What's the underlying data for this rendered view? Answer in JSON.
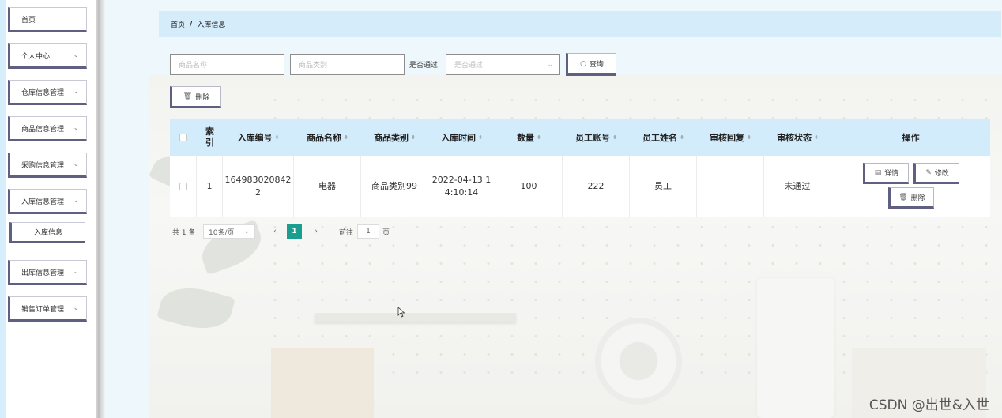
{
  "sidebar": {
    "items": [
      {
        "label": "首页",
        "chevron": false
      },
      {
        "label": "个人中心",
        "chevron": true
      },
      {
        "label": "仓库信息管理",
        "chevron": true
      },
      {
        "label": "商品信息管理",
        "chevron": true
      },
      {
        "label": "采购信息管理",
        "chevron": true
      },
      {
        "label": "入库信息管理",
        "chevron": true
      },
      {
        "label": "出库信息管理",
        "chevron": true
      },
      {
        "label": "销售订单管理",
        "chevron": true
      }
    ],
    "sub_item": "入库信息"
  },
  "breadcrumb": {
    "home": "首页",
    "separator": "/",
    "current": "入库信息"
  },
  "filters": {
    "name_placeholder": "商品名称",
    "category_placeholder": "商品类别",
    "pass_label": "是否通过",
    "pass_placeholder": "是否通过",
    "search_label": "查询",
    "delete_label": "删除"
  },
  "table": {
    "headers": [
      "索引",
      "入库编号",
      "商品名称",
      "商品类别",
      "入库时间",
      "数量",
      "员工账号",
      "员工姓名",
      "审核回复",
      "审核状态",
      "操作"
    ],
    "row": {
      "index": "1",
      "code_line1": "164983020842",
      "code_line2": "2",
      "name": "电器",
      "category": "商品类别99",
      "time_line1": "2022-04-13 1",
      "time_line2": "4:10:14",
      "qty": "100",
      "account": "222",
      "staff": "员工",
      "reply": "",
      "status": "未通过"
    },
    "actions": {
      "detail": "详情",
      "edit": "修改",
      "delete": "删除"
    }
  },
  "pagination": {
    "total": "共 1 条",
    "page_size": "10条/页",
    "current_page": "1",
    "goto_label": "前往",
    "goto_value": "1",
    "page_suffix": "页"
  },
  "watermark": "CSDN @出世&入世",
  "colors": {
    "accent_teal": "#1a9e8f",
    "header_blue": "#d3ecfb",
    "button_border": "#5f5f82"
  }
}
